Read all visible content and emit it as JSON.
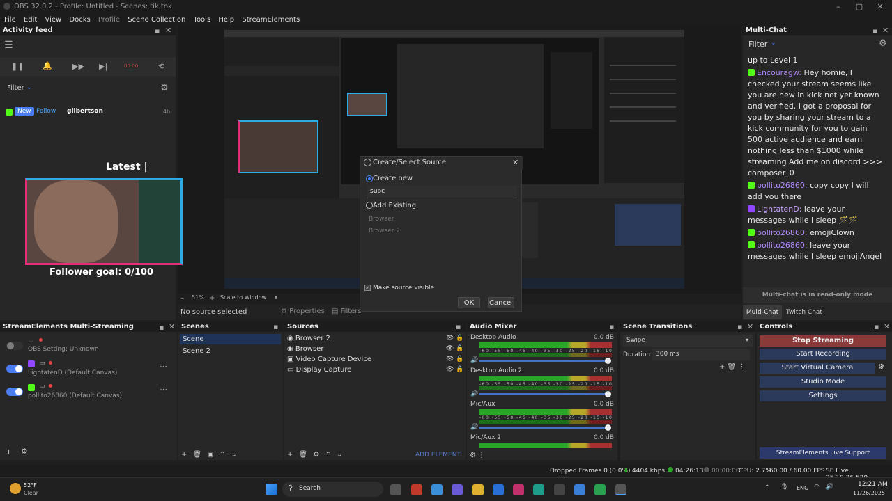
{
  "window": {
    "title": "OBS 32.0.2 - Profile: Untitled - Scenes: tik tok"
  },
  "menu": [
    "File",
    "Edit",
    "View",
    "Docks",
    "Profile",
    "Scene Collection",
    "Tools",
    "Help",
    "StreamElements"
  ],
  "activity": {
    "title": "Activity feed",
    "filter_label": "Filter",
    "timer": "00:00",
    "event": {
      "badge_new": "New",
      "badge_follow": "Follow",
      "user": "gilbertson",
      "age": "4h"
    }
  },
  "overlay": {
    "latest": "Latest |",
    "goal": "Follower goal: 0/100"
  },
  "preview_toolbar": {
    "zoom": "51%",
    "scale": "Scale to Window"
  },
  "source_bar": {
    "no_source": "No source selected",
    "properties": "Properties",
    "filters": "Filters"
  },
  "dialog": {
    "title": "Create/Select Source",
    "create_new": "Create new",
    "name_value": "supc",
    "add_existing": "Add Existing",
    "existing": [
      "Browser",
      "Browser 2"
    ],
    "make_visible": "Make source visible",
    "ok": "OK",
    "cancel": "Cancel"
  },
  "multistream": {
    "title": "StreamElements Multi-Streaming",
    "items": [
      {
        "label": "OBS Setting: Unknown"
      },
      {
        "label": "LightatenD (Default Canvas)"
      },
      {
        "label": "pollito26860 (Default Canvas)"
      }
    ]
  },
  "scenes": {
    "title": "Scenes",
    "items": [
      "Scene",
      "Scene 2"
    ]
  },
  "sources": {
    "title": "Sources",
    "items": [
      "Browser 2",
      "Browser",
      "Video Capture Device",
      "Display Capture"
    ],
    "add_element": "ADD ELEMENT"
  },
  "mixer": {
    "title": "Audio Mixer",
    "channels": [
      {
        "name": "Desktop Audio",
        "db": "0.0 dB"
      },
      {
        "name": "Desktop Audio 2",
        "db": "0.0 dB"
      },
      {
        "name": "Mic/Aux",
        "db": "0.0 dB"
      },
      {
        "name": "Mic/Aux 2",
        "db": "0.0 dB"
      }
    ],
    "scale": "-60 -55 -50 -45 -40 -35 -30 -25 -20 -15 -10 -5 0"
  },
  "transitions": {
    "title": "Scene Transitions",
    "selected": "Swipe",
    "duration_label": "Duration",
    "duration": "300 ms"
  },
  "controls": {
    "title": "Controls",
    "stop_streaming": "Stop Streaming",
    "start_recording": "Start Recording",
    "start_virtual_camera": "Start Virtual Camera",
    "studio_mode": "Studio Mode",
    "settings": "Settings",
    "live_support": "StreamElements Live Support"
  },
  "chat": {
    "title": "Multi-Chat",
    "filter_label": "Filter",
    "messages": [
      {
        "user": "",
        "text": "up to Level 1"
      },
      {
        "user": "Encouragw:",
        "text": "Hey homie, I checked your stream seems like you are new in kick not yet known and verified. I got a proposal for you by sharing your stream to a kick community for you to gain 500 active audience and earn nothing less than $1000 while streaming Add me on discord >>> composer_0"
      },
      {
        "user": "pollito26860:",
        "text": "copy copy I will add you there"
      },
      {
        "user": "LightatenD:",
        "text": "leave your messages while I sleep 🪄🪄"
      },
      {
        "user": "pollito26860:",
        "text": "emojiClown"
      },
      {
        "user": "pollito26860:",
        "text": "leave your messages while I sleep emojiAngel"
      }
    ],
    "readonly_note": "Multi-chat is in read-only mode",
    "tabs": [
      "Multi-Chat",
      "Twitch Chat"
    ]
  },
  "status": {
    "dropped": "Dropped Frames 0 (0.0%)",
    "kbps": "4404 kbps",
    "live_time": "04:26:13",
    "rec_time": "00:00:00",
    "cpu": "CPU: 2.7%",
    "fps": "60.00 / 60.00 FPS",
    "selive": "SE.Live 25.10.26.520"
  },
  "taskbar": {
    "weather_temp": "52°F",
    "weather_desc": "Clear",
    "search": "Search",
    "lang": "ENG",
    "time": "12:21 AM",
    "date": "11/26/2025"
  },
  "colors": {
    "accent": "#4a7ef0",
    "stop": "#8b3a3a",
    "kick": "#53fc18",
    "twitch": "#9146ff"
  }
}
